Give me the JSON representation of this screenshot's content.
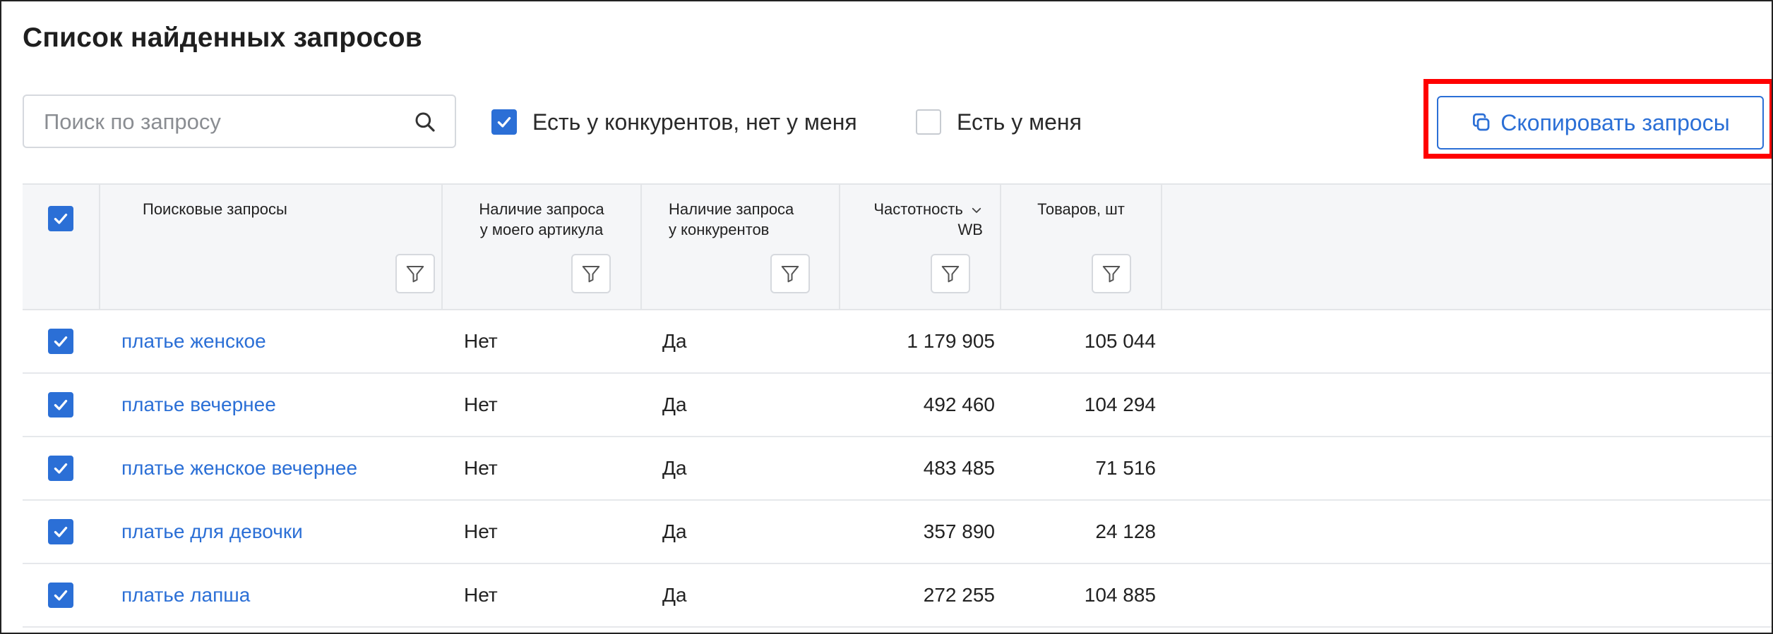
{
  "page": {
    "title": "Список найденных запросов"
  },
  "search": {
    "placeholder": "Поиск по запросу",
    "value": ""
  },
  "filters": {
    "competitors_only": {
      "label": "Есть у конкурентов, нет у меня",
      "checked": true
    },
    "mine": {
      "label": "Есть у меня",
      "checked": false
    }
  },
  "toolbar": {
    "copy_label": "Скопировать запросы"
  },
  "colors": {
    "accent": "#2b6fd6",
    "highlight": "#ff0000",
    "header_bg": "#f5f6f8"
  },
  "table": {
    "select_all_checked": true,
    "columns": {
      "query": {
        "line1": "Поисковые запросы",
        "line2": ""
      },
      "mine": {
        "line1": "Наличие запроса",
        "line2": "у моего артикула"
      },
      "competitors": {
        "line1": "Наличие запроса",
        "line2": "у конкурентов"
      },
      "frequency": {
        "line1": "Частотность",
        "line2": "WB",
        "sort": "desc"
      },
      "products": {
        "line1": "Товаров, шт",
        "line2": ""
      }
    },
    "rows": [
      {
        "checked": true,
        "query": "платье женское",
        "mine": "Нет",
        "competitors": "Да",
        "frequency": "1 179 905",
        "products": "105 044"
      },
      {
        "checked": true,
        "query": "платье вечернее",
        "mine": "Нет",
        "competitors": "Да",
        "frequency": "492 460",
        "products": "104 294"
      },
      {
        "checked": true,
        "query": "платье женское вечернее",
        "mine": "Нет",
        "competitors": "Да",
        "frequency": "483 485",
        "products": "71 516"
      },
      {
        "checked": true,
        "query": "платье для девочки",
        "mine": "Нет",
        "competitors": "Да",
        "frequency": "357 890",
        "products": "24 128"
      },
      {
        "checked": true,
        "query": "платье лапша",
        "mine": "Нет",
        "competitors": "Да",
        "frequency": "272 255",
        "products": "104 885"
      }
    ]
  },
  "icons": {
    "search": "search-icon",
    "copy": "copy-icon",
    "filter": "filter-icon",
    "sort": "chevron-down-icon",
    "check": "check-icon"
  }
}
